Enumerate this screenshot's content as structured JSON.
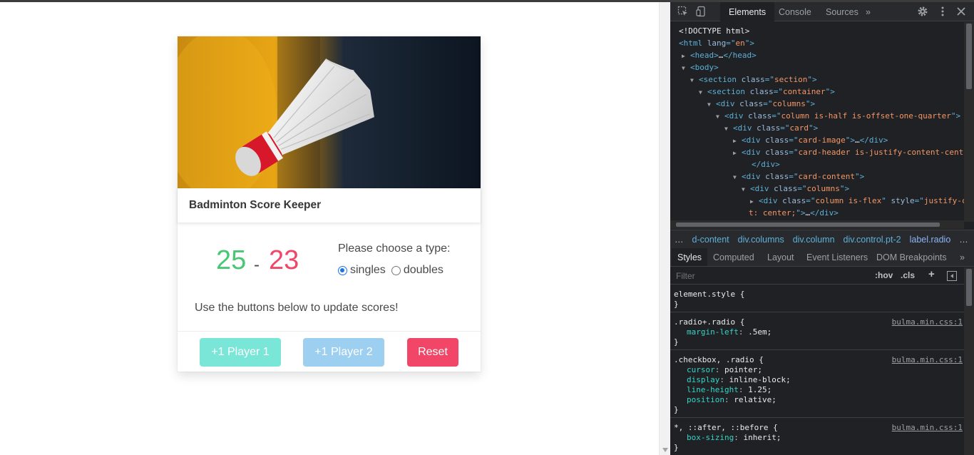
{
  "app": {
    "card_title": "Badminton Score Keeper",
    "score_p1": "25",
    "score_separator": "-",
    "score_p2": "23",
    "type_prompt": "Please choose a type:",
    "radio_options": [
      {
        "label": "singles",
        "checked": true
      },
      {
        "label": "doubles",
        "checked": false
      }
    ],
    "help_text": "Use the buttons below to update scores!",
    "buttons": {
      "player1": "+1 Player 1",
      "player2": "+1 Player 2",
      "reset": "Reset"
    },
    "colors": {
      "p1": "#48c774",
      "p2": "#f14668",
      "btn_p1": "#7ae6d7",
      "btn_p2": "#9ccff0",
      "reset": "#f14668"
    }
  },
  "devtools": {
    "tabs": [
      "Elements",
      "Console",
      "Sources"
    ],
    "more_tabs": "»",
    "dom_lines": [
      {
        "tri": "",
        "parts": [
          [
            "txt",
            "<!DOCTYPE html>"
          ]
        ]
      },
      {
        "tri": "",
        "parts": [
          [
            "tag",
            "<html "
          ],
          [
            "attr",
            "lang"
          ],
          [
            "tag",
            "=\""
          ],
          [
            "val",
            "en"
          ],
          [
            "tag",
            "\">"
          ]
        ]
      },
      {
        "tri": "▶",
        "parts": [
          [
            "tag",
            "<head>"
          ],
          [
            "txt",
            "…"
          ],
          [
            "tag",
            "</head>"
          ]
        ]
      },
      {
        "tri": "▼",
        "parts": [
          [
            "tag",
            "<body>"
          ]
        ]
      },
      {
        "tri": "▼",
        "parts": [
          [
            "tag",
            "<section "
          ],
          [
            "attr",
            "class"
          ],
          [
            "tag",
            "=\""
          ],
          [
            "val",
            "section"
          ],
          [
            "tag",
            "\">"
          ]
        ]
      },
      {
        "tri": "▼",
        "parts": [
          [
            "tag",
            "<section "
          ],
          [
            "attr",
            "class"
          ],
          [
            "tag",
            "=\""
          ],
          [
            "val",
            "container"
          ],
          [
            "tag",
            "\">"
          ]
        ]
      },
      {
        "tri": "▼",
        "parts": [
          [
            "tag",
            "<div "
          ],
          [
            "attr",
            "class"
          ],
          [
            "tag",
            "=\""
          ],
          [
            "val",
            "columns"
          ],
          [
            "tag",
            "\">"
          ]
        ]
      },
      {
        "tri": "▼",
        "parts": [
          [
            "tag",
            "<div "
          ],
          [
            "attr",
            "class"
          ],
          [
            "tag",
            "=\""
          ],
          [
            "val",
            "column is-half is-offset-one-quarter"
          ],
          [
            "tag",
            "\">"
          ]
        ]
      },
      {
        "tri": "▼",
        "parts": [
          [
            "tag",
            "<div "
          ],
          [
            "attr",
            "class"
          ],
          [
            "tag",
            "=\""
          ],
          [
            "val",
            "card"
          ],
          [
            "tag",
            "\">"
          ]
        ]
      },
      {
        "tri": "▶",
        "parts": [
          [
            "tag",
            "<div "
          ],
          [
            "attr",
            "class"
          ],
          [
            "tag",
            "=\""
          ],
          [
            "val",
            "card-image"
          ],
          [
            "tag",
            "\">"
          ],
          [
            "txt",
            "…"
          ],
          [
            "tag",
            "</div>"
          ]
        ]
      },
      {
        "tri": "▶",
        "parts": [
          [
            "tag",
            "<div "
          ],
          [
            "attr",
            "class"
          ],
          [
            "tag",
            "=\""
          ],
          [
            "val",
            "card-header is-justify-content-cente"
          ]
        ]
      },
      {
        "tri": "",
        "parts": [
          [
            "tag",
            "</div>"
          ]
        ]
      },
      {
        "tri": "▼",
        "parts": [
          [
            "tag",
            "<div "
          ],
          [
            "attr",
            "class"
          ],
          [
            "tag",
            "=\""
          ],
          [
            "val",
            "card-content"
          ],
          [
            "tag",
            "\">"
          ]
        ]
      },
      {
        "tri": "▼",
        "parts": [
          [
            "tag",
            "<div "
          ],
          [
            "attr",
            "class"
          ],
          [
            "tag",
            "=\""
          ],
          [
            "val",
            "columns"
          ],
          [
            "tag",
            "\">"
          ]
        ]
      },
      {
        "tri": "▶",
        "parts": [
          [
            "tag",
            "<div "
          ],
          [
            "attr",
            "class"
          ],
          [
            "tag",
            "=\""
          ],
          [
            "val",
            "column is-flex"
          ],
          [
            "tag",
            "\" "
          ],
          [
            "attr",
            "style"
          ],
          [
            "tag",
            "=\""
          ],
          [
            "val",
            "justify-c"
          ]
        ]
      },
      {
        "tri": "",
        "parts": [
          [
            "val",
            "t: center;"
          ],
          [
            "tag",
            "\">"
          ],
          [
            "txt",
            "…"
          ],
          [
            "tag",
            "</div>"
          ]
        ]
      }
    ],
    "breadcrumbs": [
      "…",
      "d-content",
      "div.columns",
      "div.column",
      "div.control.pt-2",
      "label.radio",
      "…"
    ],
    "styles_tabs": [
      "Styles",
      "Computed",
      "Layout",
      "Event Listeners",
      "DOM Breakpoints"
    ],
    "filter_placeholder": "Filter",
    "hov": ":hov",
    "cls": ".cls",
    "plus": "+",
    "rules": [
      {
        "selector": "element.style {",
        "source": "",
        "props": [],
        "close": "}"
      },
      {
        "selector": ".radio+.radio {",
        "source": "bulma.min.css:1",
        "props": [
          [
            "margin-left",
            ".5em;"
          ]
        ],
        "close": "}"
      },
      {
        "selector": ".checkbox, .radio {",
        "source": "bulma.min.css:1",
        "props": [
          [
            "cursor",
            "pointer;"
          ],
          [
            "display",
            "inline-block;"
          ],
          [
            "line-height",
            "1.25;"
          ],
          [
            "position",
            "relative;"
          ]
        ],
        "close": "}"
      },
      {
        "selector": "*, ::after, ::before {",
        "source": "bulma.min.css:1",
        "props": [
          [
            "box-sizing",
            "inherit;"
          ]
        ],
        "close": "}"
      }
    ]
  }
}
